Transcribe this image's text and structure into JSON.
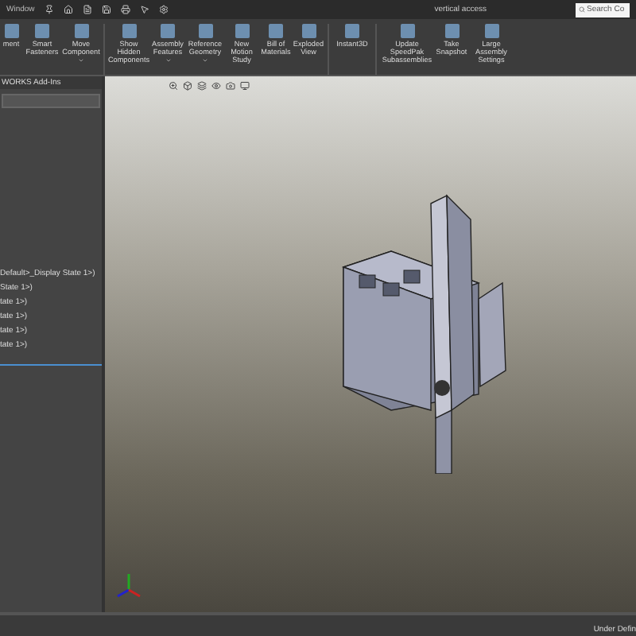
{
  "title_bar": {
    "menu": "Window",
    "title": "vertical access",
    "search": {
      "placeholder": "Search Co"
    }
  },
  "ribbon": [
    {
      "label": "ment",
      "dropdown": false
    },
    {
      "label": "Smart Fasteners",
      "dropdown": false
    },
    {
      "label": "Move Component",
      "dropdown": true
    },
    {
      "label": "Show Hidden Components",
      "dropdown": false
    },
    {
      "label": "Assembly Features",
      "dropdown": true
    },
    {
      "label": "Reference Geometry",
      "dropdown": true
    },
    {
      "label": "New Motion Study",
      "dropdown": false
    },
    {
      "label": "Bill of Materials",
      "dropdown": false
    },
    {
      "label": "Exploded View",
      "dropdown": false
    },
    {
      "label": "Instant3D",
      "dropdown": false
    },
    {
      "label": "Update SpeedPak Subassemblies",
      "dropdown": false
    },
    {
      "label": "Take Snapshot",
      "dropdown": false
    },
    {
      "label": "Large Assembly Settings",
      "dropdown": false
    }
  ],
  "panel": {
    "tab": "WORKS Add-Ins",
    "tree": [
      "Default>_Display State 1>)",
      "State 1>)",
      "tate 1>)",
      "tate 1>)",
      "tate 1>)",
      "tate 1>)"
    ]
  },
  "status_bar": {
    "text": "Under Defin"
  }
}
